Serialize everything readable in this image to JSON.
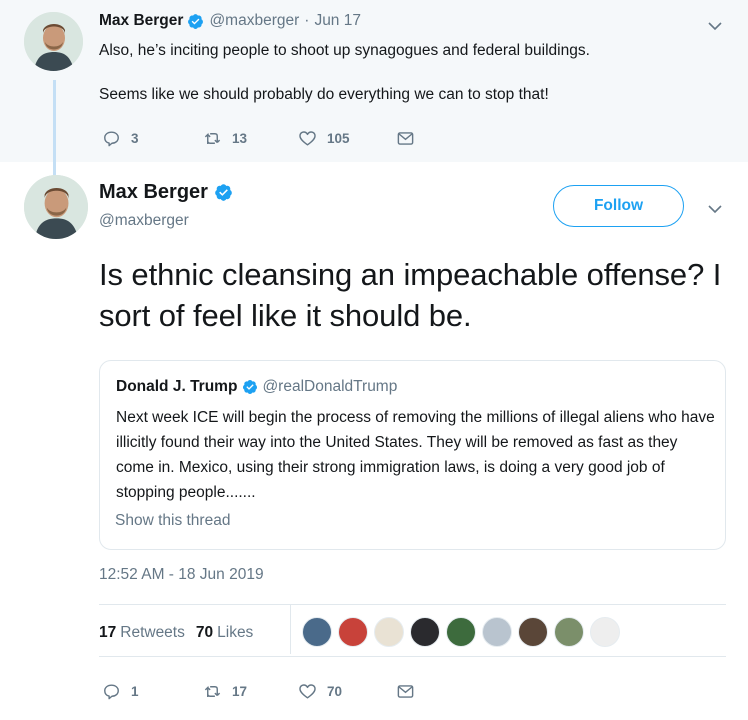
{
  "parent_tweet": {
    "name": "Max Berger",
    "handle": "@maxberger",
    "separator": "·",
    "date": "Jun 17",
    "text_lines": [
      "Also, he’s inciting people to shoot up synagogues and federal buildings.",
      "Seems like we should probably do everything we can to stop that!"
    ],
    "replies": "3",
    "retweets": "13",
    "likes": "105"
  },
  "main_tweet": {
    "name": "Max Berger",
    "handle": "@maxberger",
    "follow_label": "Follow",
    "text": "Is ethnic cleansing an impeachable offense? I sort of feel like it should be.",
    "quote": {
      "name": "Donald J. Trump",
      "handle": "@realDonaldTrump",
      "text": "Next week ICE will begin the process of removing the millions of illegal aliens who have illicitly found their way into the United States. They will be removed as fast as they come in. Mexico, using their strong immigration laws, is doing a very good job of stopping people.......",
      "show_thread": "Show this thread"
    },
    "timestamp": "12:52 AM - 18 Jun 2019",
    "retweet_count": "17",
    "retweet_label": "Retweets",
    "like_count": "70",
    "like_label": "Likes",
    "replies": "1",
    "retweets": "17",
    "likes": "70"
  },
  "liker_avatar_colors": [
    "#4a6a8a",
    "#c8423a",
    "#e9e2d4",
    "#2a2a2e",
    "#3d6b3d",
    "#b9c4cf",
    "#5a4638",
    "#7b8f6a",
    "#eeeeee"
  ],
  "colors": {
    "accent": "#1da1f2",
    "text": "#14171a",
    "secondary": "#657786",
    "parent_bg": "#f5f8fa",
    "border": "#e1e8ed"
  }
}
